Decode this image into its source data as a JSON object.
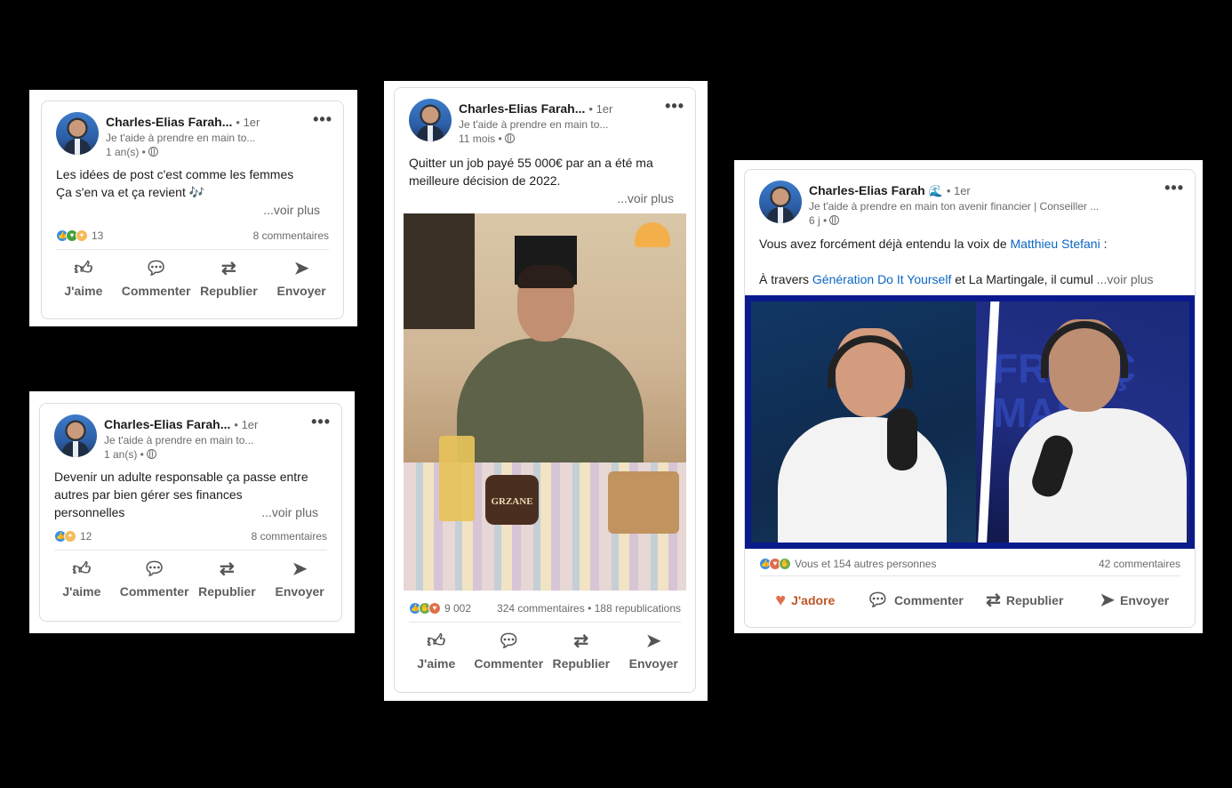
{
  "author": {
    "name": "Charles-Elias Farah...",
    "name_full": "Charles-Elias Farah",
    "name_emoji": "🌊",
    "degree": "• 1er",
    "tagline": "Je t'aide à prendre en main to...",
    "tagline_long": "Je t'aide à prendre en main ton avenir financier | Conseiller ..."
  },
  "actions": {
    "like": "J'aime",
    "love": "J'adore",
    "comment": "Commenter",
    "repost": "Republier",
    "send": "Envoyer"
  },
  "posts": [
    {
      "time": "1 an(s) •",
      "text_line1": "Les idées de post c'est comme les femmes",
      "text_line2": "Ça s'en va et ça revient 🎶",
      "voir_plus": "...voir plus",
      "reactions": "13",
      "comments": "8 commentaires"
    },
    {
      "time": "1 an(s) •",
      "text_line1": "Devenir un adulte responsable ça passe entre",
      "text_line2": "autres par bien gérer ses finances",
      "text_line3": "personnelles",
      "voir_plus": "...voir plus",
      "reactions": "12",
      "comments": "8 commentaires"
    },
    {
      "time": "11 mois •",
      "text_line1": "Quitter un job payé 55 000€ par an a été ma",
      "text_line2": "meilleure décision de 2022.",
      "voir_plus": "...voir plus",
      "reactions": "9 002",
      "comments": "324 commentaires • 188 republications",
      "image_text": "GRZANE"
    },
    {
      "time": "6 j •",
      "text_line1_prefix": "Vous avez forcément déjà entendu la voix de ",
      "mention": "Matthieu Stefani",
      "text_line1_suffix": " :",
      "text_line2_prefix": "À travers ",
      "mention2": "Génération Do It Yourself",
      "text_line2_suffix": " et La Martingale, il cumul ",
      "voir_plus": " ...voir plus",
      "reactions": "Vous et 154 autres personnes",
      "comments": "42 commentaires",
      "image_text": "FRANÇ\nMAIN"
    }
  ],
  "colors": {
    "link": "#0a66c2",
    "love": "#df704d",
    "like": "#378fe9"
  }
}
